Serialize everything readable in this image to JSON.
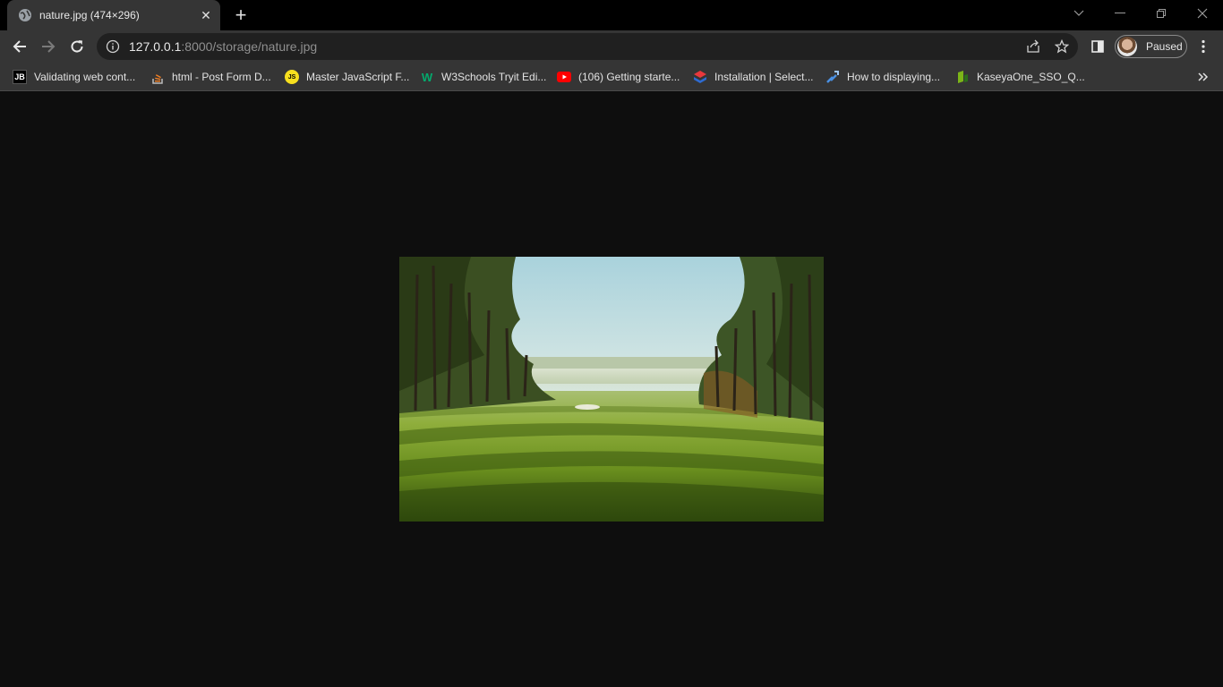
{
  "tab": {
    "title": "nature.jpg (474×296)",
    "favicon": "globe-icon"
  },
  "toolbar": {
    "url_host": "127.0.0.1",
    "url_rest": ":8000/storage/nature.jpg",
    "profile_label": "Paused"
  },
  "bookmarks": [
    {
      "label": "Validating web cont...",
      "icon": "jetbrains-icon"
    },
    {
      "label": "html - Post Form D...",
      "icon": "stackoverflow-icon"
    },
    {
      "label": "Master JavaScript F...",
      "icon": "js-icon"
    },
    {
      "label": "W3Schools Tryit Edi...",
      "icon": "w3schools-icon"
    },
    {
      "label": "(106) Getting starte...",
      "icon": "youtube-icon"
    },
    {
      "label": "Installation | Select...",
      "icon": "select2-icon"
    },
    {
      "label": "How to displaying...",
      "icon": "link-icon"
    },
    {
      "label": "KaseyaOne_SSO_Q...",
      "icon": "kaseya-icon"
    }
  ],
  "colors": {
    "frame": "#000000",
    "toolbar": "#353535",
    "omnibox": "#202020",
    "page_bg": "#0e0e0e"
  }
}
